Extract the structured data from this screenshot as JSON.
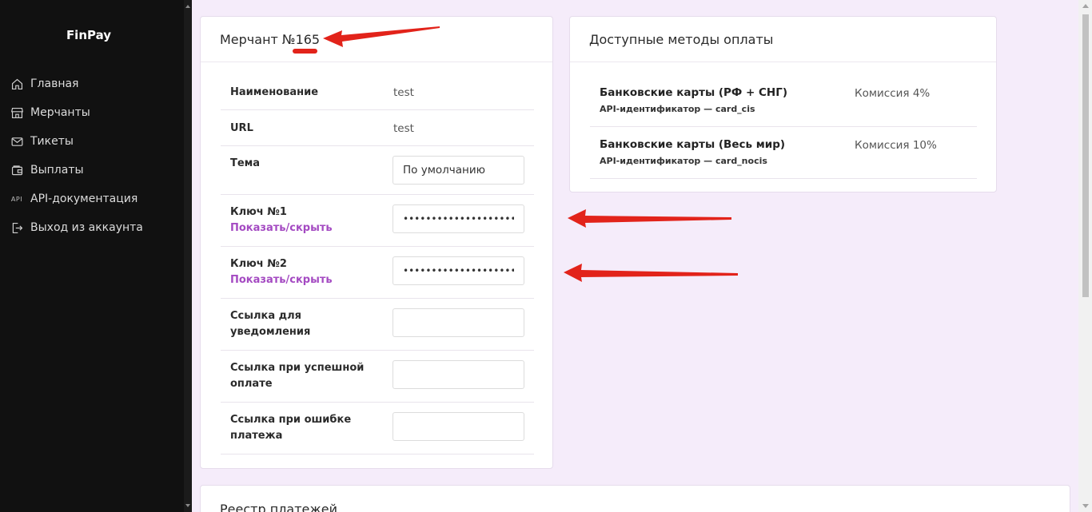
{
  "app": {
    "logo": "FinPay"
  },
  "sidebar": {
    "items": [
      {
        "label": "Главная",
        "icon": "home-icon"
      },
      {
        "label": "Мерчанты",
        "icon": "store-icon"
      },
      {
        "label": "Тикеты",
        "icon": "mail-icon"
      },
      {
        "label": "Выплаты",
        "icon": "wallet-icon"
      },
      {
        "label": "API-документация",
        "icon": "api-icon",
        "icon_text": "API"
      },
      {
        "label": "Выход из аккаунта",
        "icon": "logout-icon"
      }
    ]
  },
  "merchant": {
    "title": "Мерчант №165",
    "name_label": "Наименование",
    "name_value": "test",
    "url_label": "URL",
    "url_value": "test",
    "theme_label": "Тема",
    "theme_value": "По умолчанию",
    "key1_label": "Ключ №1",
    "key1_toggle": "Показать/скрыть",
    "key1_value": "•••••••••••••••••••••",
    "key2_label": "Ключ №2",
    "key2_toggle": "Показать/скрыть",
    "key2_value": "•••••••••••••••••••••",
    "notify_label_1": "Ссылка для",
    "notify_label_2": "уведомления",
    "success_label_1": "Ссылка при успешной",
    "success_label_2": "оплате",
    "error_label_1": "Ссылка при ошибке",
    "error_label_2": "платежа"
  },
  "methods": {
    "title": "Доступные методы оплаты",
    "items": [
      {
        "name": "Банковские карты (РФ + СНГ)",
        "api_id": "API-идентификатор — card_cis",
        "fee": "Комиссия 4%"
      },
      {
        "name": "Банковские карты (Весь мир)",
        "api_id": "API-идентификатор — card_nocis",
        "fee": "Комиссия 10%"
      }
    ]
  },
  "registry": {
    "title": "Реестр платежей"
  },
  "colors": {
    "sidebar_bg": "#111111",
    "page_bg": "#f5ecfa",
    "accent": "#a44ac2",
    "annotation": "#e2231a"
  }
}
